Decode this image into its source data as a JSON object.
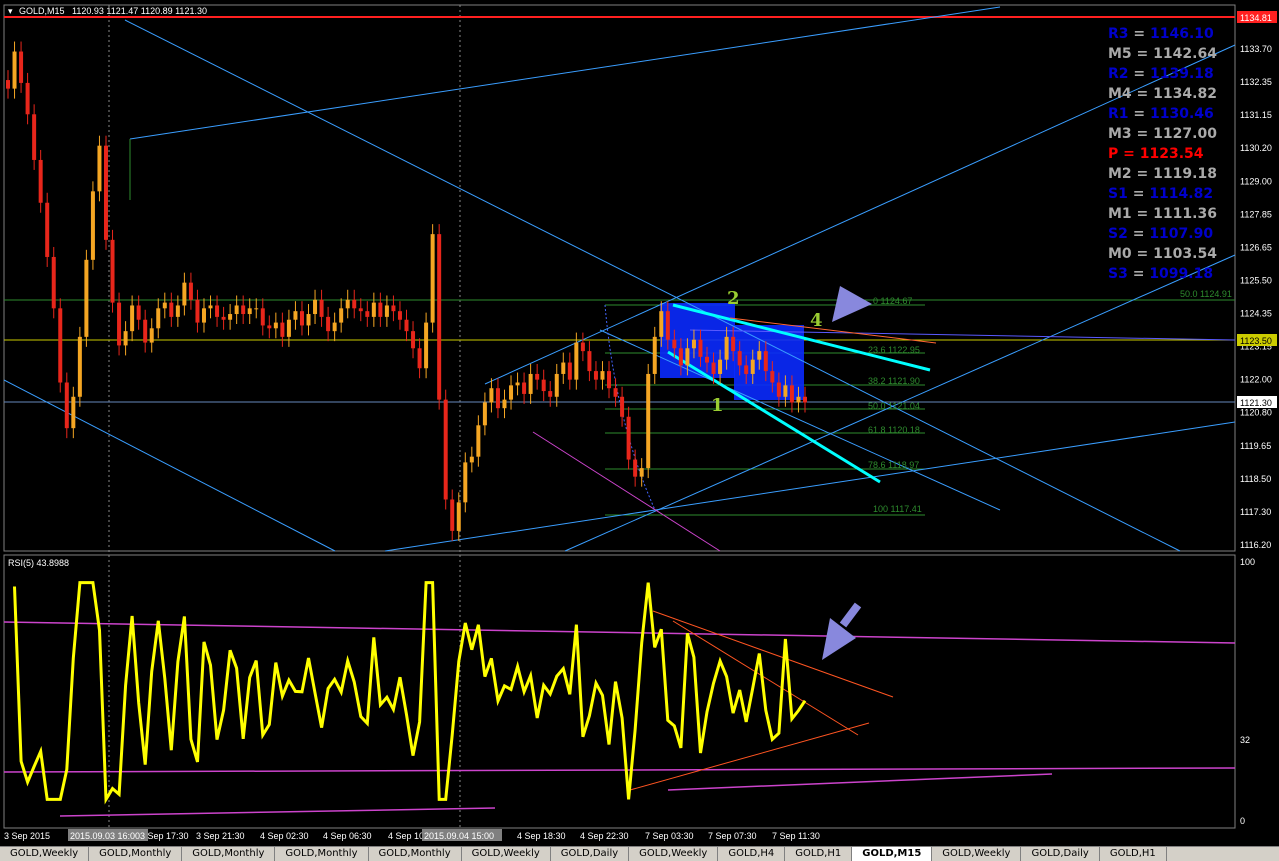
{
  "header": {
    "symbol": "GOLD,M15",
    "ohlc": "1120.93 1121.47 1120.89 1121.30"
  },
  "price_axis": {
    "ticks": [
      "1133.70",
      "1132.35",
      "1131.15",
      "1130.20",
      "1129.00",
      "1127.85",
      "1126.65",
      "1125.50",
      "1124.35",
      "1123.15",
      "1122.00",
      "1120.80",
      "1119.65",
      "1118.50",
      "1117.30",
      "1116.20"
    ],
    "red_label": "1134.81",
    "yellow_label": "1123.50",
    "current_label": "1121.30"
  },
  "pivots": [
    {
      "name": "R3",
      "value": "1146.10",
      "color": "#0000cc"
    },
    {
      "name": "M5",
      "value": "1142.64",
      "color": "#a9a9a9"
    },
    {
      "name": "R2",
      "value": "1139.18",
      "color": "#0000cc"
    },
    {
      "name": "M4",
      "value": "1134.82",
      "color": "#a9a9a9"
    },
    {
      "name": "R1",
      "value": "1130.46",
      "color": "#0000cc"
    },
    {
      "name": "M3",
      "value": "1127.00",
      "color": "#a9a9a9"
    },
    {
      "name": "P ",
      "value": "1123.54",
      "color": "#ff0000"
    },
    {
      "name": "M2",
      "value": "1119.18",
      "color": "#a9a9a9"
    },
    {
      "name": "S1",
      "value": "1114.82",
      "color": "#0000cc"
    },
    {
      "name": "M1",
      "value": "1111.36",
      "color": "#a9a9a9"
    },
    {
      "name": "S2",
      "value": "1107.90",
      "color": "#0000cc"
    },
    {
      "name": "M0",
      "value": "1103.54",
      "color": "#a9a9a9"
    },
    {
      "name": "S3",
      "value": "1099.18",
      "color": "#0000cc"
    }
  ],
  "fib": [
    {
      "label": "0 1124.67"
    },
    {
      "label": "23.6 1122.95"
    },
    {
      "label": "38.2 1121.90"
    },
    {
      "label": "50.0 1121.04"
    },
    {
      "label": "61.8 1120.18"
    },
    {
      "label": "78.6 1118.97"
    },
    {
      "label": "100 1117.41"
    }
  ],
  "fib_extra": "50.0 1124.91",
  "wave_labels": {
    "w1": "1",
    "w2": "2",
    "w4": "4"
  },
  "rsi": {
    "label": "RSI(5) 43.8988",
    "top": "100",
    "mid": "32",
    "bottom": "0"
  },
  "time_axis": [
    "3 Sep 2015",
    "2015.09.03 16:00",
    "3 Sep 17:30",
    "3 Sep 21:30",
    "4 Sep 02:30",
    "4 Sep 06:30",
    "4 Sep 10:30",
    "2015.09.04 15:00",
    "4 Sep 18:30",
    "4 Sep 22:30",
    "7 Sep 03:30",
    "7 Sep 07:30",
    "7 Sep 11:30"
  ],
  "tabs": [
    "GOLD,Weekly",
    "GOLD,Monthly",
    "GOLD,Monthly",
    "GOLD,Monthly",
    "GOLD,Monthly",
    "GOLD,Weekly",
    "GOLD,Daily",
    "GOLD,Weekly",
    "GOLD,H4",
    "GOLD,H1",
    "GOLD,M15",
    "GOLD,Weekly",
    "GOLD,Daily",
    "GOLD,H1"
  ],
  "active_tab": 10,
  "colors": {
    "bull": "#f5a623",
    "bear": "#e8261b",
    "rsi": "#ffff00",
    "trend": "#3a9eff",
    "cyan": "#00ffff",
    "magenta": "#cc44cc",
    "fib": "#2e8b2e",
    "box": "#0a2aff"
  },
  "chart_data": {
    "type": "candlestick",
    "instrument": "GOLD",
    "timeframe": "M15",
    "ylim": [
      1116.2,
      1134.81
    ],
    "closes": [
      1132.3,
      1133.6,
      1132.5,
      1131.4,
      1129.8,
      1128.3,
      1126.4,
      1124.6,
      1122.0,
      1120.4,
      1121.5,
      1123.6,
      1126.3,
      1128.7,
      1130.3,
      1127.0,
      1124.8,
      1123.3,
      1123.8,
      1124.7,
      1124.2,
      1123.4,
      1123.9,
      1124.6,
      1124.8,
      1124.3,
      1124.7,
      1125.5,
      1124.9,
      1124.1,
      1124.6,
      1124.7,
      1124.3,
      1124.2,
      1124.4,
      1124.7,
      1124.4,
      1124.6,
      1124.6,
      1124.0,
      1123.9,
      1124.1,
      1123.6,
      1124.2,
      1124.5,
      1124.0,
      1124.4,
      1124.9,
      1124.3,
      1123.8,
      1124.1,
      1124.6,
      1124.9,
      1124.6,
      1124.5,
      1124.3,
      1124.8,
      1124.3,
      1124.7,
      1124.5,
      1124.2,
      1123.8,
      1123.2,
      1122.5,
      1124.1,
      1127.2,
      1121.4,
      1117.9,
      1116.8,
      1117.8,
      1119.2,
      1119.4,
      1120.5,
      1121.3,
      1121.8,
      1121.1,
      1121.4,
      1121.9,
      1122.0,
      1121.6,
      1122.3,
      1122.1,
      1121.7,
      1121.5,
      1122.3,
      1122.7,
      1122.1,
      1123.4,
      1123.1,
      1122.4,
      1122.1,
      1122.4,
      1121.8,
      1121.5,
      1120.8,
      1119.3,
      1118.7,
      1119.0,
      1122.3,
      1123.6,
      1124.5,
      1123.5,
      1123.2,
      1122.6,
      1123.2,
      1123.5,
      1122.9,
      1122.7,
      1122.3,
      1122.8,
      1123.6,
      1123.1,
      1122.6,
      1122.3,
      1122.8,
      1123.1,
      1122.4,
      1122.0,
      1121.5,
      1121.9,
      1121.3,
      1121.5,
      1121.3
    ]
  }
}
